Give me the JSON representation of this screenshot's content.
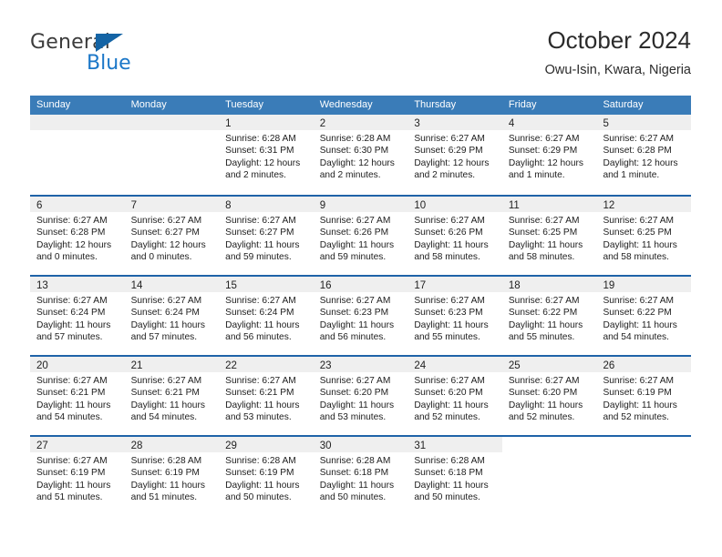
{
  "brand": {
    "word1": "General",
    "word2": "Blue",
    "logo_icon": "blue-triangle-icon",
    "accent_color": "#1464a5",
    "blue_text_color": "#1b77c8"
  },
  "header": {
    "title": "October 2024",
    "location": "Owu-Isin, Kwara, Nigeria"
  },
  "colors": {
    "header_row_bg": "#3a7cb8",
    "week_separator": "#1f63a8",
    "day_band_bg": "#efefef",
    "page_bg": "#ffffff",
    "text": "#1d1d1d"
  },
  "weekdays": [
    "Sunday",
    "Monday",
    "Tuesday",
    "Wednesday",
    "Thursday",
    "Friday",
    "Saturday"
  ],
  "weeks": [
    [
      {
        "day": "",
        "sunrise": "",
        "sunset": "",
        "daylight1": "",
        "daylight2": "",
        "empty": true
      },
      {
        "day": "",
        "sunrise": "",
        "sunset": "",
        "daylight1": "",
        "daylight2": "",
        "empty": true
      },
      {
        "day": "1",
        "sunrise": "Sunrise: 6:28 AM",
        "sunset": "Sunset: 6:31 PM",
        "daylight1": "Daylight: 12 hours",
        "daylight2": "and 2 minutes."
      },
      {
        "day": "2",
        "sunrise": "Sunrise: 6:28 AM",
        "sunset": "Sunset: 6:30 PM",
        "daylight1": "Daylight: 12 hours",
        "daylight2": "and 2 minutes."
      },
      {
        "day": "3",
        "sunrise": "Sunrise: 6:27 AM",
        "sunset": "Sunset: 6:29 PM",
        "daylight1": "Daylight: 12 hours",
        "daylight2": "and 2 minutes."
      },
      {
        "day": "4",
        "sunrise": "Sunrise: 6:27 AM",
        "sunset": "Sunset: 6:29 PM",
        "daylight1": "Daylight: 12 hours",
        "daylight2": "and 1 minute."
      },
      {
        "day": "5",
        "sunrise": "Sunrise: 6:27 AM",
        "sunset": "Sunset: 6:28 PM",
        "daylight1": "Daylight: 12 hours",
        "daylight2": "and 1 minute."
      }
    ],
    [
      {
        "day": "6",
        "sunrise": "Sunrise: 6:27 AM",
        "sunset": "Sunset: 6:28 PM",
        "daylight1": "Daylight: 12 hours",
        "daylight2": "and 0 minutes."
      },
      {
        "day": "7",
        "sunrise": "Sunrise: 6:27 AM",
        "sunset": "Sunset: 6:27 PM",
        "daylight1": "Daylight: 12 hours",
        "daylight2": "and 0 minutes."
      },
      {
        "day": "8",
        "sunrise": "Sunrise: 6:27 AM",
        "sunset": "Sunset: 6:27 PM",
        "daylight1": "Daylight: 11 hours",
        "daylight2": "and 59 minutes."
      },
      {
        "day": "9",
        "sunrise": "Sunrise: 6:27 AM",
        "sunset": "Sunset: 6:26 PM",
        "daylight1": "Daylight: 11 hours",
        "daylight2": "and 59 minutes."
      },
      {
        "day": "10",
        "sunrise": "Sunrise: 6:27 AM",
        "sunset": "Sunset: 6:26 PM",
        "daylight1": "Daylight: 11 hours",
        "daylight2": "and 58 minutes."
      },
      {
        "day": "11",
        "sunrise": "Sunrise: 6:27 AM",
        "sunset": "Sunset: 6:25 PM",
        "daylight1": "Daylight: 11 hours",
        "daylight2": "and 58 minutes."
      },
      {
        "day": "12",
        "sunrise": "Sunrise: 6:27 AM",
        "sunset": "Sunset: 6:25 PM",
        "daylight1": "Daylight: 11 hours",
        "daylight2": "and 58 minutes."
      }
    ],
    [
      {
        "day": "13",
        "sunrise": "Sunrise: 6:27 AM",
        "sunset": "Sunset: 6:24 PM",
        "daylight1": "Daylight: 11 hours",
        "daylight2": "and 57 minutes."
      },
      {
        "day": "14",
        "sunrise": "Sunrise: 6:27 AM",
        "sunset": "Sunset: 6:24 PM",
        "daylight1": "Daylight: 11 hours",
        "daylight2": "and 57 minutes."
      },
      {
        "day": "15",
        "sunrise": "Sunrise: 6:27 AM",
        "sunset": "Sunset: 6:24 PM",
        "daylight1": "Daylight: 11 hours",
        "daylight2": "and 56 minutes."
      },
      {
        "day": "16",
        "sunrise": "Sunrise: 6:27 AM",
        "sunset": "Sunset: 6:23 PM",
        "daylight1": "Daylight: 11 hours",
        "daylight2": "and 56 minutes."
      },
      {
        "day": "17",
        "sunrise": "Sunrise: 6:27 AM",
        "sunset": "Sunset: 6:23 PM",
        "daylight1": "Daylight: 11 hours",
        "daylight2": "and 55 minutes."
      },
      {
        "day": "18",
        "sunrise": "Sunrise: 6:27 AM",
        "sunset": "Sunset: 6:22 PM",
        "daylight1": "Daylight: 11 hours",
        "daylight2": "and 55 minutes."
      },
      {
        "day": "19",
        "sunrise": "Sunrise: 6:27 AM",
        "sunset": "Sunset: 6:22 PM",
        "daylight1": "Daylight: 11 hours",
        "daylight2": "and 54 minutes."
      }
    ],
    [
      {
        "day": "20",
        "sunrise": "Sunrise: 6:27 AM",
        "sunset": "Sunset: 6:21 PM",
        "daylight1": "Daylight: 11 hours",
        "daylight2": "and 54 minutes."
      },
      {
        "day": "21",
        "sunrise": "Sunrise: 6:27 AM",
        "sunset": "Sunset: 6:21 PM",
        "daylight1": "Daylight: 11 hours",
        "daylight2": "and 54 minutes."
      },
      {
        "day": "22",
        "sunrise": "Sunrise: 6:27 AM",
        "sunset": "Sunset: 6:21 PM",
        "daylight1": "Daylight: 11 hours",
        "daylight2": "and 53 minutes."
      },
      {
        "day": "23",
        "sunrise": "Sunrise: 6:27 AM",
        "sunset": "Sunset: 6:20 PM",
        "daylight1": "Daylight: 11 hours",
        "daylight2": "and 53 minutes."
      },
      {
        "day": "24",
        "sunrise": "Sunrise: 6:27 AM",
        "sunset": "Sunset: 6:20 PM",
        "daylight1": "Daylight: 11 hours",
        "daylight2": "and 52 minutes."
      },
      {
        "day": "25",
        "sunrise": "Sunrise: 6:27 AM",
        "sunset": "Sunset: 6:20 PM",
        "daylight1": "Daylight: 11 hours",
        "daylight2": "and 52 minutes."
      },
      {
        "day": "26",
        "sunrise": "Sunrise: 6:27 AM",
        "sunset": "Sunset: 6:19 PM",
        "daylight1": "Daylight: 11 hours",
        "daylight2": "and 52 minutes."
      }
    ],
    [
      {
        "day": "27",
        "sunrise": "Sunrise: 6:27 AM",
        "sunset": "Sunset: 6:19 PM",
        "daylight1": "Daylight: 11 hours",
        "daylight2": "and 51 minutes."
      },
      {
        "day": "28",
        "sunrise": "Sunrise: 6:28 AM",
        "sunset": "Sunset: 6:19 PM",
        "daylight1": "Daylight: 11 hours",
        "daylight2": "and 51 minutes."
      },
      {
        "day": "29",
        "sunrise": "Sunrise: 6:28 AM",
        "sunset": "Sunset: 6:19 PM",
        "daylight1": "Daylight: 11 hours",
        "daylight2": "and 50 minutes."
      },
      {
        "day": "30",
        "sunrise": "Sunrise: 6:28 AM",
        "sunset": "Sunset: 6:18 PM",
        "daylight1": "Daylight: 11 hours",
        "daylight2": "and 50 minutes."
      },
      {
        "day": "31",
        "sunrise": "Sunrise: 6:28 AM",
        "sunset": "Sunset: 6:18 PM",
        "daylight1": "Daylight: 11 hours",
        "daylight2": "and 50 minutes."
      },
      {
        "day": "",
        "sunrise": "",
        "sunset": "",
        "daylight1": "",
        "daylight2": "",
        "empty": true,
        "noband": true
      },
      {
        "day": "",
        "sunrise": "",
        "sunset": "",
        "daylight1": "",
        "daylight2": "",
        "empty": true,
        "noband": true
      }
    ]
  ]
}
